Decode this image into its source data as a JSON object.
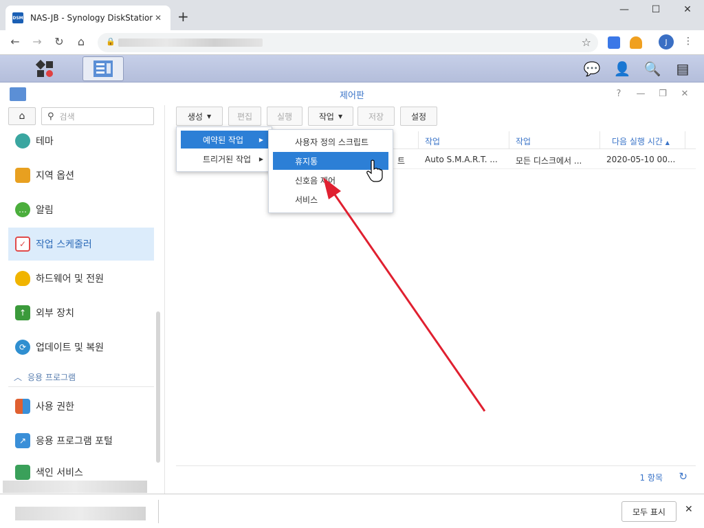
{
  "browser": {
    "tab_title": "NAS-JB - Synology DiskStation",
    "favicon_text": "DSM",
    "tab_close": "✕",
    "new_tab": "+",
    "minimize": "—",
    "maximize": "☐",
    "close": "✕",
    "avatar_letter": "J"
  },
  "window": {
    "title": "제어판",
    "help": "?",
    "minimize": "—",
    "restore": "❐",
    "close": "✕"
  },
  "sidebar": {
    "search_placeholder": "검색",
    "items": [
      {
        "label": "테마",
        "color": "#3aa6a0"
      },
      {
        "label": "지역 옵션",
        "color": "#e8a020"
      },
      {
        "label": "알림",
        "color": "#4bae3c"
      },
      {
        "label": "작업 스케줄러",
        "color": "#e04a4a"
      },
      {
        "label": "하드웨어 및 전원",
        "color": "#f0b400"
      },
      {
        "label": "외부 장치",
        "color": "#3b9a3b"
      },
      {
        "label": "업데이트 및 복원",
        "color": "#2f8fd0"
      }
    ],
    "section_label": "응용 프로그램",
    "items2": [
      {
        "label": "사용 권한",
        "color": "#e06030"
      },
      {
        "label": "응용 프로그램 포털",
        "color": "#3a8fd8"
      },
      {
        "label": "색인 서비스",
        "color": "#3aa05a"
      }
    ]
  },
  "toolbar": {
    "create": "생성",
    "edit": "편집",
    "run": "실행",
    "action": "작업",
    "save": "저장",
    "settings": "설정"
  },
  "grid": {
    "headers": [
      "작업",
      "작업",
      "다음 실행 시간"
    ],
    "row": {
      "partial": "트",
      "task": "Auto S.M.A.R.T. ...",
      "action": "모든 디스크에서 ...",
      "next_run": "2020-05-10 00..."
    },
    "count": "1 항목"
  },
  "menu1": {
    "scheduled": "예약된 작업",
    "triggered": "트리거된 작업"
  },
  "menu2": {
    "items": [
      "사용자 정의 스크립트",
      "휴지통",
      "신호음 제어",
      "서비스"
    ]
  },
  "notification": {
    "show_all": "모두 표시",
    "close": "✕"
  },
  "colors": {
    "accent": "#3a74c8",
    "highlight": "#2c7fd6",
    "arrow": "#e02030"
  }
}
